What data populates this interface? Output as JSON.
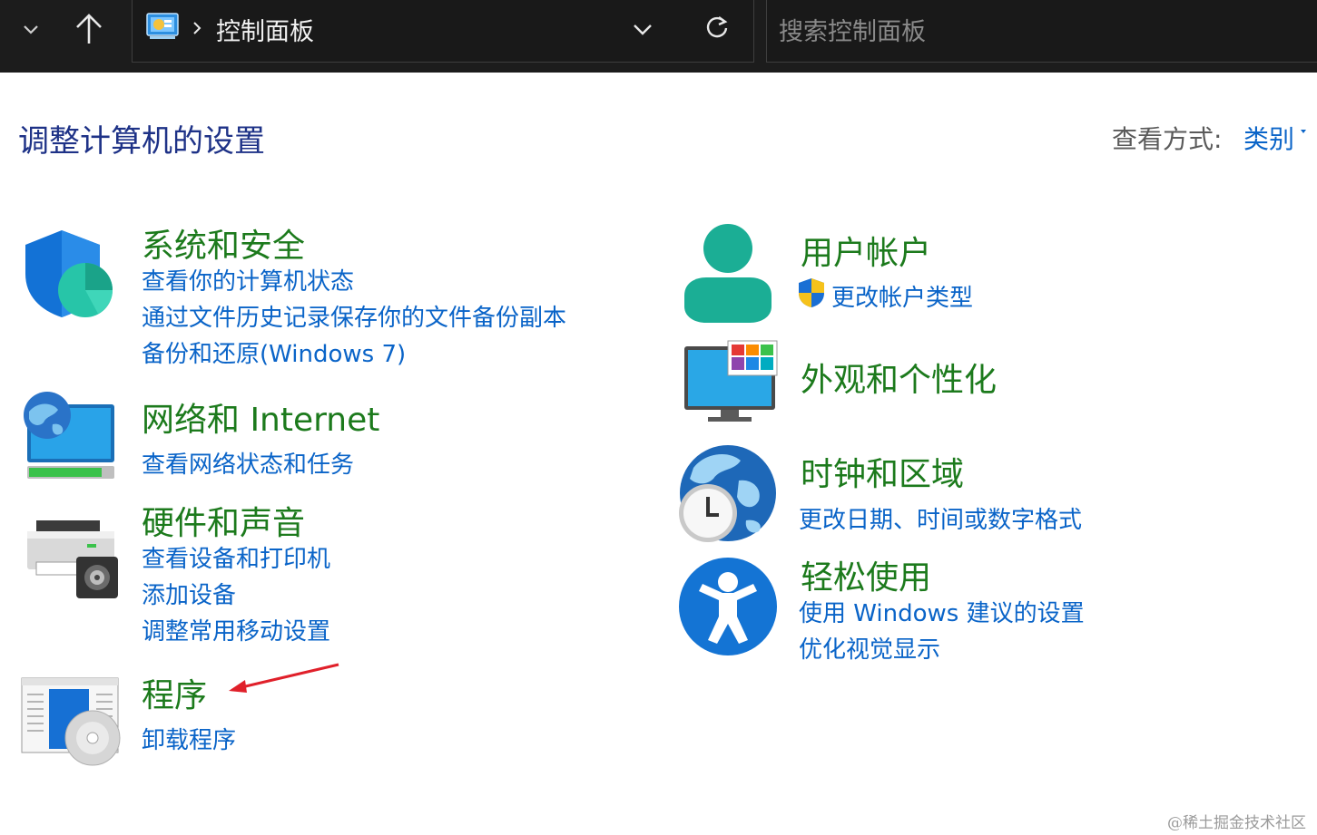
{
  "window": {
    "address_root": "控制面板",
    "search_placeholder": "搜索控制面板"
  },
  "header": {
    "title": "调整计算机的设置",
    "view_by_label": "查看方式:",
    "view_by_value": "类别"
  },
  "categories": {
    "system_security": {
      "title": "系统和安全",
      "links": [
        "查看你的计算机状态",
        "通过文件历史记录保存你的文件备份副本",
        "备份和还原(Windows 7)"
      ]
    },
    "network": {
      "title": "网络和 Internet",
      "links": [
        "查看网络状态和任务"
      ]
    },
    "hardware": {
      "title": "硬件和声音",
      "links": [
        "查看设备和打印机",
        "添加设备",
        "调整常用移动设置"
      ]
    },
    "programs": {
      "title": "程序",
      "links": [
        "卸载程序"
      ]
    },
    "user_accounts": {
      "title": "用户帐户",
      "links": [
        "更改帐户类型"
      ]
    },
    "appearance": {
      "title": "外观和个性化",
      "links": []
    },
    "clock_region": {
      "title": "时钟和区域",
      "links": [
        "更改日期、时间或数字格式"
      ]
    },
    "ease_of_access": {
      "title": "轻松使用",
      "links": [
        "使用 Windows 建议的设置",
        "优化视觉显示"
      ]
    }
  },
  "annotation": {
    "arrow_color": "#e0202a"
  },
  "watermark": "@稀土掘金技术社区",
  "colors": {
    "title_green": "#1c7a1c",
    "link_blue": "#0a64c8",
    "heading_navy": "#1e3287",
    "topbar_bg": "#1c1c1c"
  }
}
